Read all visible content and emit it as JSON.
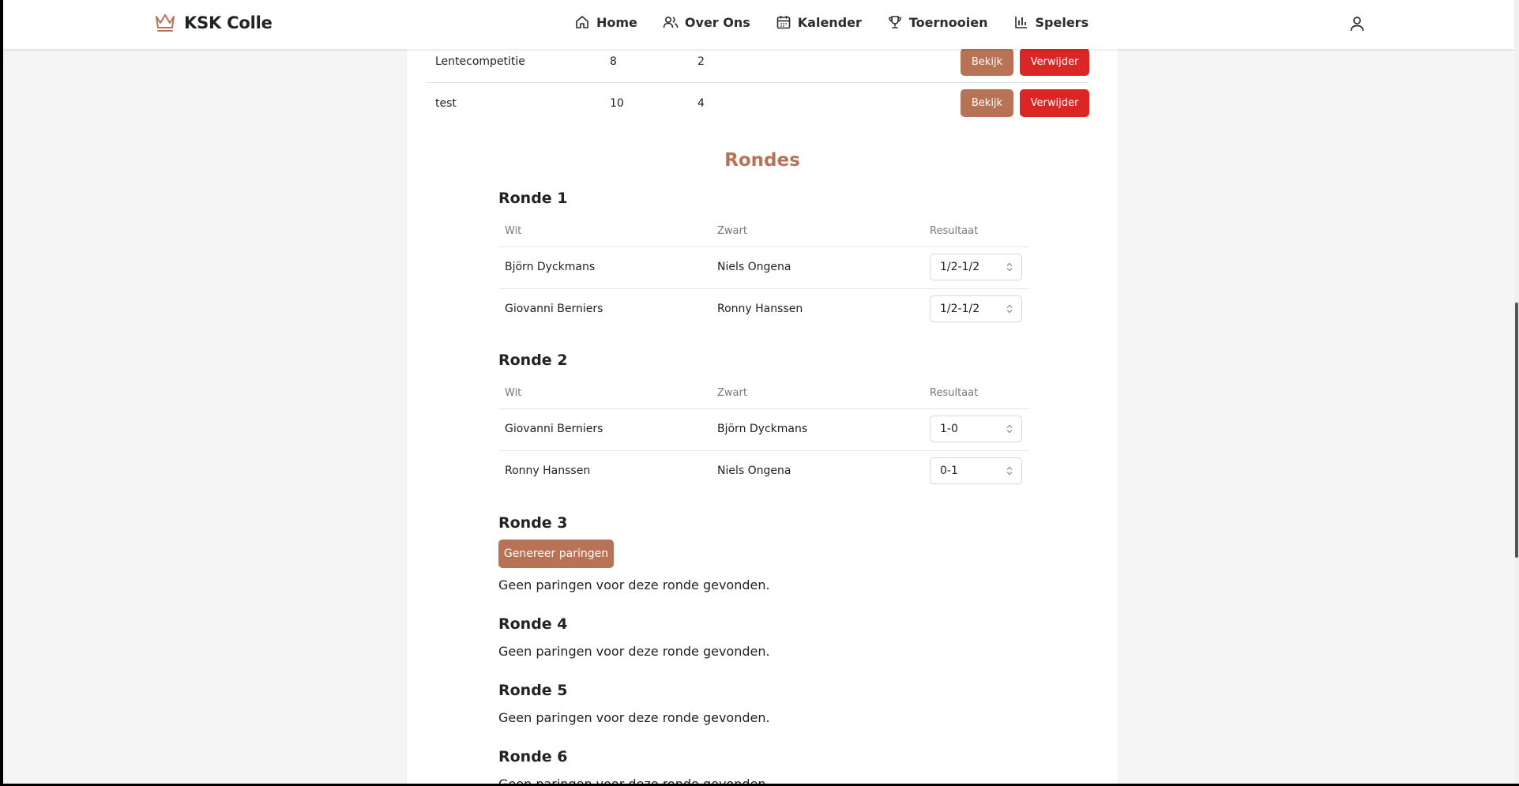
{
  "header": {
    "brand": "KSK Colle",
    "nav": [
      {
        "label": "Home",
        "icon": "home-icon"
      },
      {
        "label": "Over Ons",
        "icon": "users-icon"
      },
      {
        "label": "Kalender",
        "icon": "calendar-icon"
      },
      {
        "label": "Toernooien",
        "icon": "trophy-icon"
      },
      {
        "label": "Spelers",
        "icon": "bar-chart-icon"
      }
    ],
    "user_icon": "user-icon"
  },
  "tournaments": [
    {
      "name": "Lentecompetitie",
      "col1": "8",
      "col2": "2",
      "view_label": "Bekijk",
      "delete_label": "Verwijder"
    },
    {
      "name": "test",
      "col1": "10",
      "col2": "4",
      "view_label": "Bekijk",
      "delete_label": "Verwijder"
    }
  ],
  "rounds_title": "Rondes",
  "columns": {
    "white": "Wit",
    "black": "Zwart",
    "result": "Resultaat"
  },
  "rounds": [
    {
      "title": "Ronde 1",
      "pairings": [
        {
          "white": "Björn Dyckmans",
          "black": "Niels Ongena",
          "result": "1/2-1/2"
        },
        {
          "white": "Giovanni Berniers",
          "black": "Ronny Hanssen",
          "result": "1/2-1/2"
        }
      ]
    },
    {
      "title": "Ronde 2",
      "pairings": [
        {
          "white": "Giovanni Berniers",
          "black": "Björn Dyckmans",
          "result": "1-0"
        },
        {
          "white": "Ronny Hanssen",
          "black": "Niels Ongena",
          "result": "0-1"
        }
      ]
    },
    {
      "title": "Ronde 3",
      "generate_label": "Genereer paringen",
      "empty": "Geen paringen voor deze ronde gevonden."
    },
    {
      "title": "Ronde 4",
      "empty": "Geen paringen voor deze ronde gevonden."
    },
    {
      "title": "Ronde 5",
      "empty": "Geen paringen voor deze ronde gevonden."
    },
    {
      "title": "Ronde 6",
      "empty": "Geen paringen voor deze ronde gevonden."
    }
  ],
  "colors": {
    "accent": "#b87356",
    "danger": "#dc2626",
    "background": "#f5f5f5"
  }
}
